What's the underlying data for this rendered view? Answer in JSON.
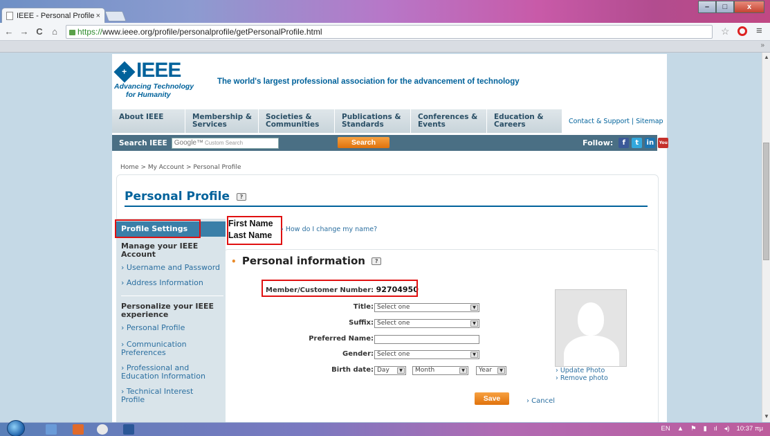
{
  "browser": {
    "tab_title": "IEEE - Personal Profile",
    "tab_close": "×",
    "url_https": "https://",
    "url_rest": "www.ieee.org/profile/personalprofile/getPersonalProfile.html",
    "nav_back": "←",
    "nav_forward": "→",
    "nav_reload": "C",
    "nav_home": "⌂",
    "win_min": "–",
    "win_max": "□",
    "win_close": "x",
    "bookmark_chevron": "»"
  },
  "header": {
    "logo_word": "IEEE",
    "logo_tag1": "Advancing Technology",
    "logo_tag2": "for Humanity",
    "tagline": "The world's largest professional association for the advancement of technology",
    "nav": [
      {
        "l1": "About IEEE",
        "l2": ""
      },
      {
        "l1": "Membership &",
        "l2": "Services"
      },
      {
        "l1": "Societies &",
        "l2": "Communities"
      },
      {
        "l1": "Publications &",
        "l2": "Standards"
      },
      {
        "l1": "Conferences &",
        "l2": "Events"
      },
      {
        "l1": "Education &",
        "l2": "Careers"
      }
    ],
    "contact": "Contact & Support | Sitemap"
  },
  "search": {
    "label": "Search IEEE",
    "google": "Google™",
    "placeholder": "Custom Search",
    "button": "Search",
    "follow": "Follow:",
    "social": [
      "f",
      "t",
      "in",
      "You"
    ]
  },
  "breadcrumb": "Home  >  My Account  >  Personal Profile",
  "page_title": "Personal Profile",
  "help_glyph": "?",
  "sidebar": {
    "active": "Profile Settings",
    "group1_title": "Manage your IEEE Account",
    "group1_links": [
      "› Username and Password",
      "› Address Information"
    ],
    "group2_title": "Personalize your IEEE experience",
    "group2_links": [
      "› Personal Profile",
      "› Communication Preferences",
      "› Professional and Education Information",
      "› Technical Interest Profile"
    ]
  },
  "name": {
    "first": "First Name",
    "last": "Last Name",
    "change_link": "› How do I change my name?"
  },
  "personal": {
    "bullet": "•",
    "title": "Personal information",
    "member_label": "Member/Customer Number:",
    "member_number": "92704950",
    "fields": {
      "title_label": "Title:",
      "title_value": "Select one",
      "suffix_label": "Suffix:",
      "suffix_value": "Select one",
      "preferred_label": "Preferred Name:",
      "preferred_value": "",
      "gender_label": "Gender:",
      "gender_value": "Select one",
      "birth_label": "Birth date:",
      "day": "Day",
      "month": "Month",
      "year": "Year"
    },
    "update_photo": "› Update Photo",
    "remove_photo": "› Remove photo",
    "save": "Save",
    "cancel": "› Cancel"
  },
  "taskbar": {
    "lang": "EN",
    "time": "10:37 πμ"
  },
  "colors": {
    "brand": "#00629b",
    "accent_orange": "#e98b2a",
    "highlight_red": "#e01010",
    "sidebar_active": "#3a7fa8"
  }
}
